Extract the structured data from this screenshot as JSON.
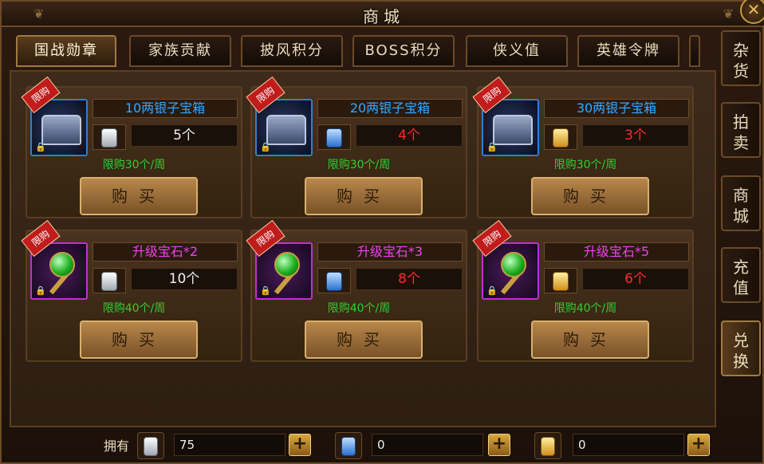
{
  "window": {
    "title": "商城"
  },
  "tabs": [
    {
      "label": "国战勋章",
      "active": true
    },
    {
      "label": "家族贡献",
      "active": false
    },
    {
      "label": "披风积分",
      "active": false
    },
    {
      "label": "BOSS积分",
      "active": false
    },
    {
      "label": "侠义值",
      "active": false
    },
    {
      "label": "英雄令牌",
      "active": false
    }
  ],
  "side_tabs": [
    {
      "label": "杂货",
      "line1": "杂",
      "line2": "货",
      "active": false
    },
    {
      "label": "拍卖",
      "line1": "拍",
      "line2": "卖",
      "active": false
    },
    {
      "label": "商城",
      "line1": "商",
      "line2": "城",
      "active": false
    },
    {
      "label": "充值",
      "line1": "充",
      "line2": "值",
      "active": false
    },
    {
      "label": "兑换",
      "line1": "兑",
      "line2": "换",
      "active": true
    }
  ],
  "items": [
    {
      "badge": "限购",
      "name": "10两银子宝箱",
      "price": "5个",
      "limit": "限购30个/周",
      "buy": "购买",
      "icon": "treasure-chest-icon",
      "currency": "silver-token-icon"
    },
    {
      "badge": "限购",
      "name": "20两银子宝箱",
      "price": "4个",
      "limit": "限购30个/周",
      "buy": "购买",
      "icon": "treasure-chest-icon",
      "currency": "blue-token-icon"
    },
    {
      "badge": "限购",
      "name": "30两银子宝箱",
      "price": "3个",
      "limit": "限购30个/周",
      "buy": "购买",
      "icon": "treasure-chest-icon",
      "currency": "gold-token-icon"
    },
    {
      "badge": "限购",
      "name": "升级宝石*2",
      "price": "10个",
      "limit": "限购40个/周",
      "buy": "购买",
      "icon": "green-gem-staff-icon",
      "currency": "silver-token-icon"
    },
    {
      "badge": "限购",
      "name": "升级宝石*3",
      "price": "8个",
      "limit": "限购40个/周",
      "buy": "购买",
      "icon": "green-gem-staff-icon",
      "currency": "blue-token-icon"
    },
    {
      "badge": "限购",
      "name": "升级宝石*5",
      "price": "6个",
      "limit": "限购40个/周",
      "buy": "购买",
      "icon": "green-gem-staff-icon",
      "currency": "gold-token-icon"
    }
  ],
  "wallet": {
    "label": "拥有",
    "balances": [
      {
        "currency": "silver-token-icon",
        "value": "75"
      },
      {
        "currency": "blue-token-icon",
        "value": "0"
      },
      {
        "currency": "gold-token-icon",
        "value": "0"
      }
    ],
    "plus": "+"
  },
  "colors": {
    "name_blue": "#35a8ff",
    "name_purple": "#f040f0",
    "price_red": "#ff2a2a",
    "limit_green": "#30d030"
  }
}
